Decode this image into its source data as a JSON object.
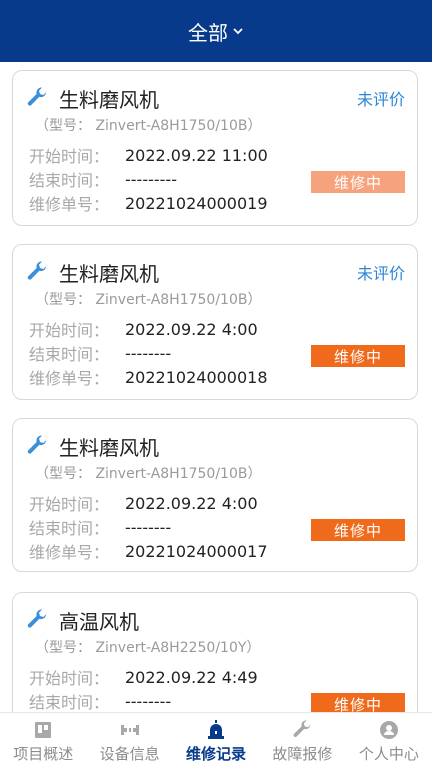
{
  "header": {
    "title": "全部"
  },
  "labels": {
    "model_prefix": "（型号：",
    "model_suffix": "）",
    "start": "开始时间：",
    "end": "结束时间：",
    "order": "维修单号："
  },
  "records": [
    {
      "name": "生料磨风机",
      "rating": "未评价",
      "model": "（型号：  Zinvert-A8H1750/10B）",
      "start_time": "2022.09.22 11:00",
      "end_time": "---------",
      "order_no": "20221024000019",
      "status": "维修中",
      "status_color": "#f5a27d"
    },
    {
      "name": "生料磨风机",
      "rating": "未评价",
      "model": "（型号：  Zinvert-A8H1750/10B）",
      "start_time": "2022.09.22 4:00",
      "end_time": "--------",
      "order_no": "20221024000018",
      "status": "维修中",
      "status_color": "#f06a1c"
    },
    {
      "name": "生料磨风机",
      "rating": "",
      "model": "（型号：  Zinvert-A8H1750/10B）",
      "start_time": "2022.09.22 4:00",
      "end_time": "--------",
      "order_no": "20221024000017",
      "status": "维修中",
      "status_color": "#f06a1c"
    },
    {
      "name": "高温风机",
      "rating": "",
      "model": "（型号：  Zinvert-A8H2250/10Y）",
      "start_time": "2022.09.22 4:49",
      "end_time": "--------",
      "order_no": "",
      "status": "维修中",
      "status_color": "#f06a1c"
    }
  ],
  "tabs": [
    {
      "label": "项目概述",
      "icon": "project-icon",
      "active": false
    },
    {
      "label": "设备信息",
      "icon": "device-icon",
      "active": false
    },
    {
      "label": "维修记录",
      "icon": "alarm-icon",
      "active": true
    },
    {
      "label": "故障报修",
      "icon": "wrench-icon",
      "active": false
    },
    {
      "label": "个人中心",
      "icon": "user-icon",
      "active": false
    }
  ],
  "colors": {
    "header_bg": "#083a8c",
    "accent": "#2c86d6",
    "status_orange": "#f06a1c",
    "status_light": "#f5a27d"
  }
}
